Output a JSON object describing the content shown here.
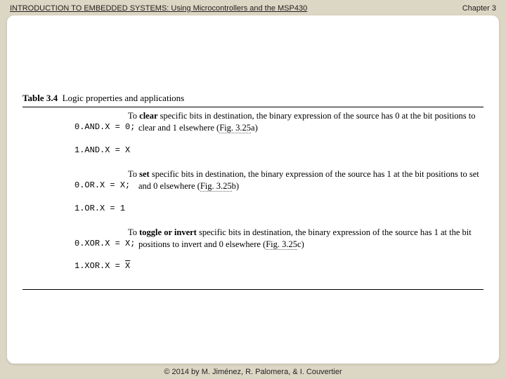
{
  "header": {
    "title": "INTRODUCTION TO EMBEDDED SYSTEMS: Using Microcontrollers and the MSP430",
    "chapter": "Chapter 3"
  },
  "footer": {
    "copyright": "© 2014 by M. Jiménez, R. Palomera, & I. Couvertier"
  },
  "table": {
    "number": "Table 3.4",
    "title": "Logic properties and applications",
    "rows": [
      {
        "expr1": "0.AND.X = 0;",
        "expr2": "1.AND.X = X",
        "lead": "To ",
        "kw": "clear",
        "body": " specific bits in destination, the binary expression of the source has 0 at the bit positions to clear and 1 elsewhere (",
        "figref": "Fig. 3.25",
        "tail": "a)"
      },
      {
        "expr1": "0.OR.X = X;",
        "expr2": "1.OR.X = 1",
        "lead": "To ",
        "kw": "set",
        "body": " specific bits in destination, the binary expression of the source has 1 at the bit positions to set and 0 elsewhere (",
        "figref": "Fig. 3.25",
        "tail": "b)"
      },
      {
        "expr1": "0.XOR.X = X;",
        "expr2_pre": "1.XOR.X = ",
        "expr2_bar": "X",
        "lead": "To ",
        "kw": "toggle or invert",
        "body": " specific bits in destination, the binary expression of the source has 1 at the bit positions to invert and 0 elsewhere (",
        "figref": "Fig. 3.25",
        "tail": "c)"
      }
    ]
  }
}
